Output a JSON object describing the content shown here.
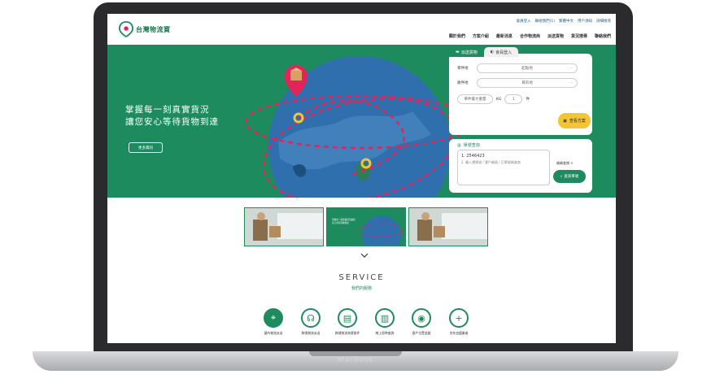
{
  "device": {
    "brand": "MacBook"
  },
  "header": {
    "logo_text": "台灣物流寶",
    "top_links": [
      "會員登入",
      "聯絡我們(1)",
      "繁體中文",
      "用戶須知",
      "詳細搜尋"
    ],
    "nav": [
      "關於我們",
      "方案介紹",
      "最新消息",
      "合作物流商",
      "派送貨物",
      "貨況搜尋",
      "聯絡我們"
    ]
  },
  "hero": {
    "headline_line1": "掌握每一刻真實貨況",
    "headline_line2": "讓您安心等待貨物到達",
    "more_button": "更多資訊",
    "accent": "#1d8b5e",
    "route_color": "#e2245a",
    "pin_color": "#f3c433"
  },
  "quote_panel": {
    "tab_active": "派送貨物",
    "tab_inactive": "會員登入",
    "sender_label": "寄件地",
    "sender_placeholder": "起點地",
    "receiver_label": "收件地",
    "receiver_placeholder": "目的地",
    "weight_placeholder": "單件最大重量",
    "weight_unit": "KG",
    "qty_value": "1",
    "qty_unit": "件",
    "calc_button": "查看方案"
  },
  "track_panel": {
    "title": "單號查詢",
    "line1": "1.  2546423",
    "line2": "2.  輸入運單號 / 客戶編號 / 訂單號碼查詢",
    "tip": "條碼查詢 >",
    "query_button": "查詢單號"
  },
  "thumbs": {
    "active_caption": "掌握每一刻真實貨況讓您安心等待貨物到達"
  },
  "services": {
    "title": "SERVICE",
    "subtitle": "我們的服務",
    "items": [
      {
        "label": "國內物流派送",
        "icon": "tag-icon"
      },
      {
        "label": "跨境物流派送",
        "icon": "headset-icon"
      },
      {
        "label": "跨境物流海運貨件",
        "icon": "chat-icon"
      },
      {
        "label": "線上即時查詢",
        "icon": "barcode-icon"
      },
      {
        "label": "客戶位置追蹤",
        "icon": "location-icon"
      },
      {
        "label": "合作加盟業者",
        "icon": "plus-icon"
      }
    ]
  }
}
